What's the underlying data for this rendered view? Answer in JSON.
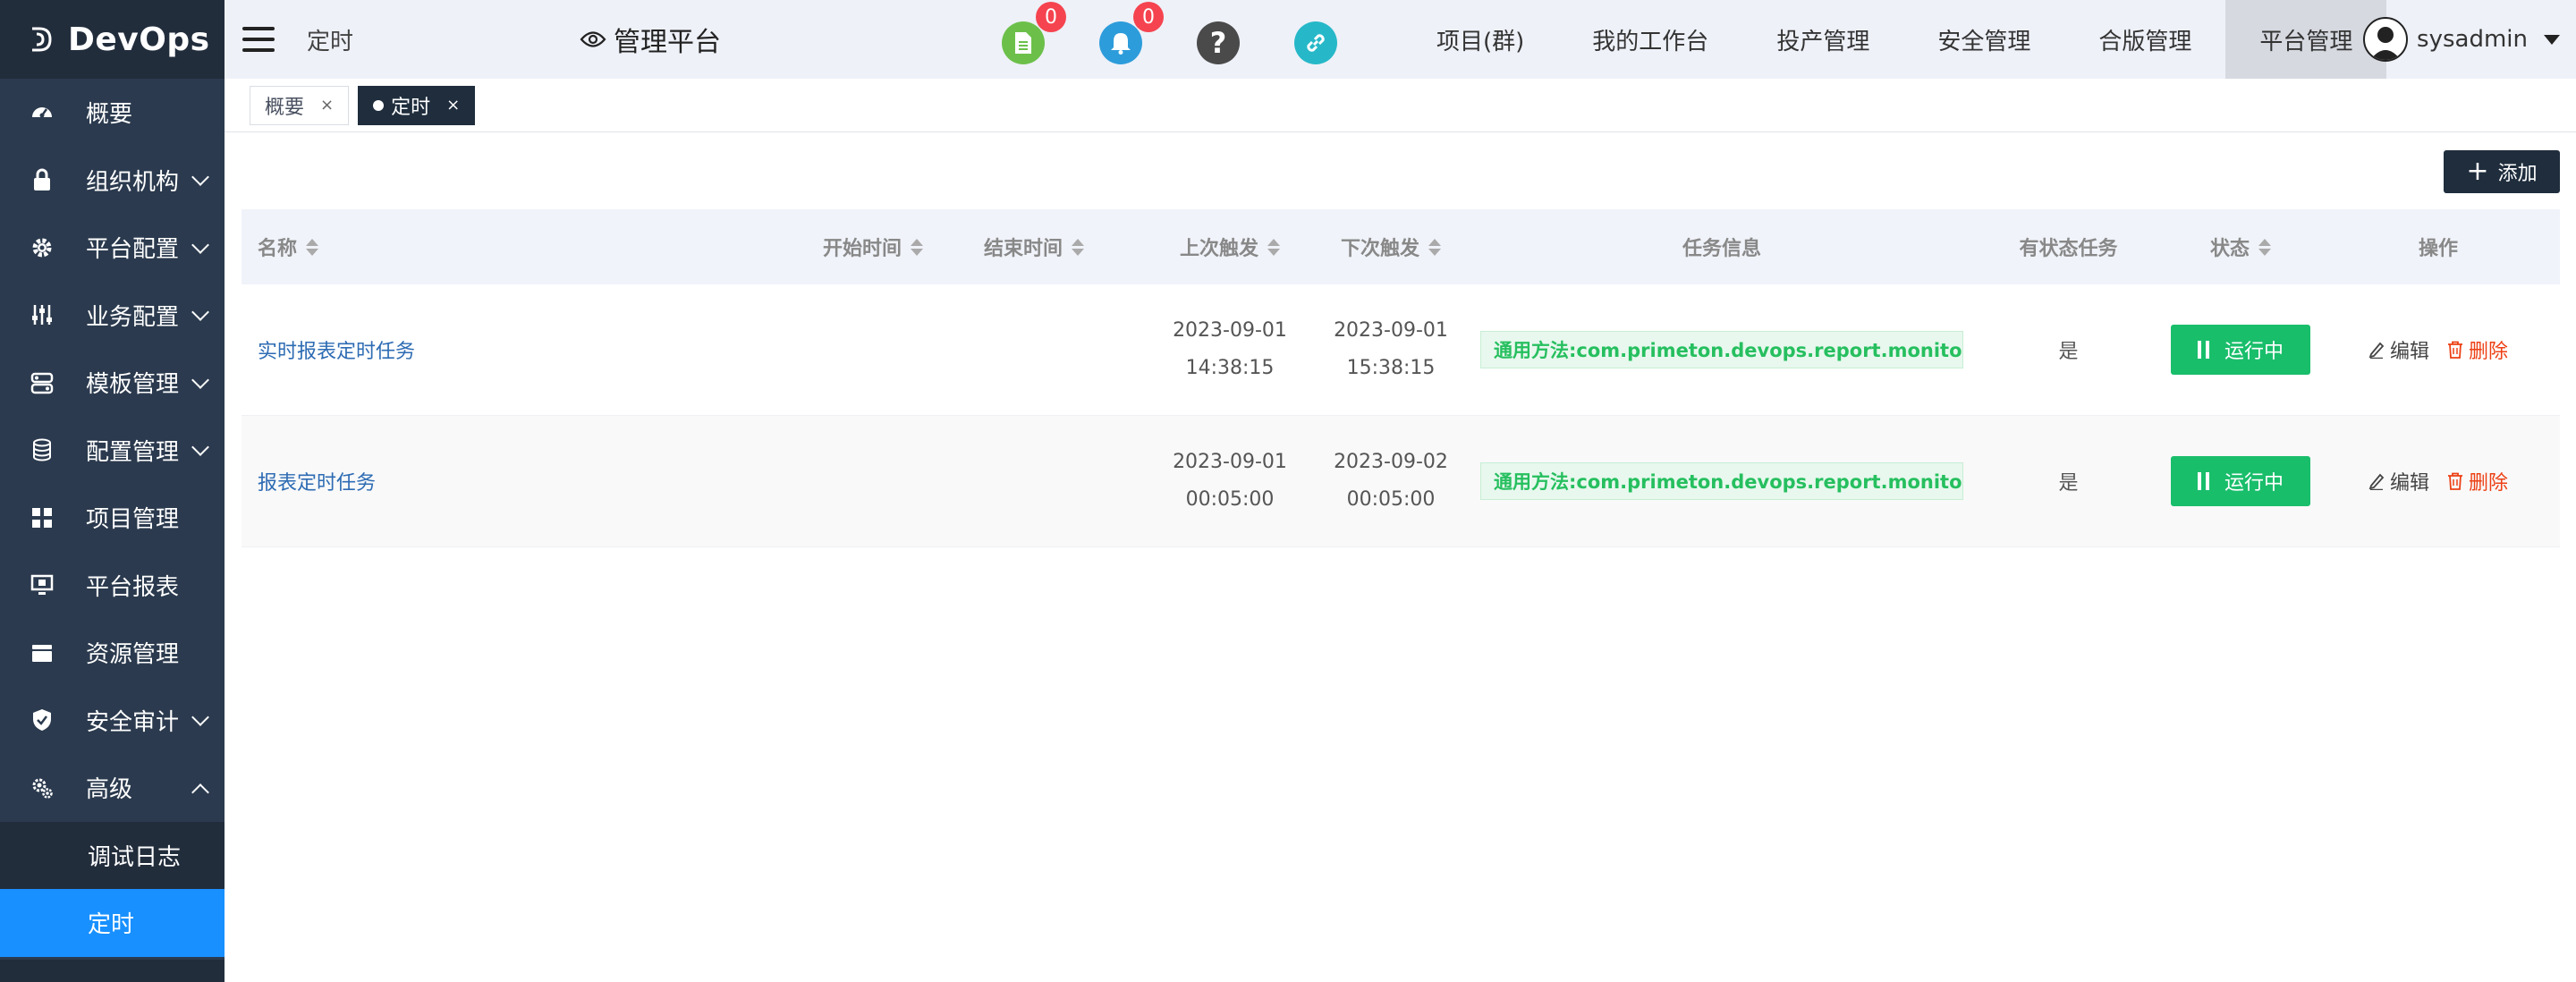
{
  "app": {
    "logo_text": "DevOps"
  },
  "sidebar": {
    "items": [
      {
        "label": "概要",
        "icon": "dashboard-icon",
        "has_arrow": false
      },
      {
        "label": "组织机构",
        "icon": "lock-icon",
        "has_arrow": true
      },
      {
        "label": "平台配置",
        "icon": "gear-icon",
        "has_arrow": true
      },
      {
        "label": "业务配置",
        "icon": "sliders-icon",
        "has_arrow": true
      },
      {
        "label": "模板管理",
        "icon": "template-icon",
        "has_arrow": true
      },
      {
        "label": "配置管理",
        "icon": "database-icon",
        "has_arrow": true
      },
      {
        "label": "项目管理",
        "icon": "grid-icon",
        "has_arrow": false
      },
      {
        "label": "平台报表",
        "icon": "monitor-icon",
        "has_arrow": false
      },
      {
        "label": "资源管理",
        "icon": "folder-icon",
        "has_arrow": false
      },
      {
        "label": "安全审计",
        "icon": "shield-icon",
        "has_arrow": true
      },
      {
        "label": "高级",
        "icon": "gears-icon",
        "has_arrow": true,
        "expanded": true
      }
    ],
    "subitems": [
      {
        "label": "调试日志",
        "active": false
      },
      {
        "label": "定时",
        "active": true
      }
    ]
  },
  "header": {
    "breadcrumb": "定时",
    "platform_label": "管理平台",
    "icons": [
      {
        "name": "document-icon",
        "color": "#6cc04a",
        "badge": "0"
      },
      {
        "name": "bell-icon",
        "color": "#2d9cdb",
        "badge": "0"
      },
      {
        "name": "help-icon",
        "color": "#4a4a4a",
        "badge": ""
      },
      {
        "name": "link-icon",
        "color": "#26b8c8",
        "badge": ""
      }
    ],
    "nav": [
      {
        "label": "项目(群)",
        "active": false
      },
      {
        "label": "我的工作台",
        "active": false
      },
      {
        "label": "投产管理",
        "active": false
      },
      {
        "label": "安全管理",
        "active": false
      },
      {
        "label": "合版管理",
        "active": false
      },
      {
        "label": "平台管理",
        "active": true
      }
    ],
    "username": "sysadmin"
  },
  "tabs": [
    {
      "label": "概要",
      "active": false,
      "close": "×"
    },
    {
      "label": "定时",
      "active": true,
      "close": "×"
    }
  ],
  "toolbar": {
    "add_label": "添加"
  },
  "table": {
    "columns": {
      "name": "名称",
      "start": "开始时间",
      "end": "结束时间",
      "last": "上次触发",
      "next": "下次触发",
      "info": "任务信息",
      "stateful": "有状态任务",
      "status": "状态",
      "actions": "操作"
    },
    "rows": [
      {
        "name": "实时报表定时任务",
        "start": "",
        "end": "",
        "last_date": "2023-09-01",
        "last_time": "14:38:15",
        "next_date": "2023-09-01",
        "next_time": "15:38:15",
        "info": "通用方法:com.primeton.devops.report.monitor.…",
        "stateful": "是",
        "status": "运行中",
        "edit": "编辑",
        "delete": "删除"
      },
      {
        "name": "报表定时任务",
        "start": "",
        "end": "",
        "last_date": "2023-09-01",
        "last_time": "00:05:00",
        "next_date": "2023-09-02",
        "next_time": "00:05:00",
        "info": "通用方法:com.primeton.devops.report.monitor.…",
        "stateful": "是",
        "status": "运行中",
        "edit": "编辑",
        "delete": "删除"
      }
    ]
  },
  "colors": {
    "sidebar_bg": "#2b3a4e",
    "active_blue": "#1890ff",
    "running_green": "#19be6b",
    "delete_red": "#ed4014"
  }
}
